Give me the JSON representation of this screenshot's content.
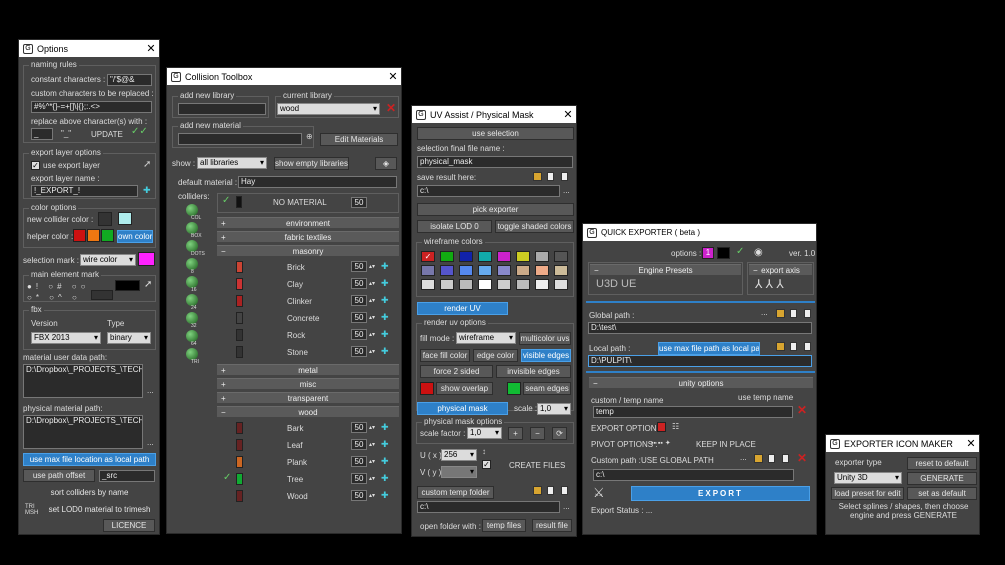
{
  "options": {
    "title": "Options",
    "naming_rules": "naming rules",
    "constant_label": "constant characters :",
    "constant_value": "\"/'$@&",
    "custom_label": "custom characters to be replaced :",
    "custom_value": "#%^*{}-=+[]\\|{};:.<>",
    "replace_label": "replace above character(s) with :",
    "replace_value": "_",
    "quote": "\"_\"",
    "update": "UPDATE",
    "export_layer_options": "export layer options",
    "use_export_layer": "use export layer",
    "export_layer_name_label": "export layer name :",
    "export_layer_name": "!_EXPORT_!",
    "color_options": "color options",
    "new_collider_color": "new collider color :",
    "helper_color": "helper color :",
    "own_color": "own color",
    "selection_mark": "selection mark :",
    "wire_color": "wire color",
    "main_element_mark": "main element mark",
    "fbx": "fbx",
    "version_label": "Version",
    "type_label": "Type",
    "version": "FBX 2013",
    "type": "binary",
    "mat_user_data_label": "material user data path:",
    "mat_user_data": "D:\\Dropbox\\_PROJECTS_\\TECH\\Scripts\\multi_exporter\\ini\\phx_user_data.ini",
    "phys_mat_label": "physical material path:",
    "phys_mat": "D:\\Dropbox\\_PROJECTS_\\TECH\\Scripts\\multi_exporter\\ini\\phx_mat.ini",
    "use_max_file": "use max file location as local path",
    "use_path_offset": "use path offset",
    "path_offset": "_src",
    "sort_colliders": "sort colliders by name",
    "set_lod0": "set LOD0 material to trimesh",
    "licence": "LICENCE",
    "ellipsis": "..."
  },
  "collision": {
    "title": "Collision Toolbox",
    "add_new_library": "add new library",
    "current_library": "current library",
    "current_value": "wood",
    "add_new_material": "add new material",
    "edit_materials": "Edit Materials",
    "show_label": "show :",
    "show_value": "all libraries",
    "show_empty": "show empty libraries",
    "default_material_label": "default material :",
    "default_material": "Hay",
    "colliders": "colliders:",
    "no_material": "NO MATERIAL",
    "num_default": "50",
    "groups": [
      {
        "name": "environment",
        "open": false
      },
      {
        "name": "fabric textiles",
        "open": false
      },
      {
        "name": "masonry",
        "open": true,
        "items": [
          "Brick",
          "Clay",
          "Clinker",
          "Concrete",
          "Rock",
          "Stone"
        ]
      },
      {
        "name": "metal",
        "open": false
      },
      {
        "name": "misc",
        "open": false
      },
      {
        "name": "transparent",
        "open": false
      },
      {
        "name": "wood",
        "open": true,
        "items": [
          "Bark",
          "Leaf",
          "Plank",
          "Tree",
          "Wood"
        ]
      }
    ],
    "collider_labels": [
      "COL",
      "BOX",
      "DOTS",
      "8",
      "16",
      "24",
      "32",
      "64",
      "TRI"
    ]
  },
  "uv": {
    "title": "UV Assist / Physical Mask",
    "use_selection": "use selection",
    "final_name_label": "selection final file name :",
    "final_name": "physical_mask",
    "save_result": "save result here:",
    "save_path": "c:\\",
    "pick_exporter": "pick exporter",
    "isolate_lod0": "isolate LOD 0",
    "toggle_shaded": "toggle shaded colors",
    "wireframe_colors": "wireframe colors",
    "render_uv": "render UV",
    "render_uv_options": "render uv options",
    "fill_mode": "fill mode :",
    "fill_value": "wireframe",
    "multicolor": "multicolor uvs",
    "face_fill": "face fill color",
    "edge_color": "edge color",
    "visible_edges": "visible edges",
    "force_2sided": "force 2 sided",
    "invisible_edges": "invisible edges",
    "show_overlap": "show overlap",
    "seam_edges": "seam edges",
    "physical_mask": "physical mask",
    "scale_label": "scale :",
    "scale_value": "1,0",
    "phys_mask_options": "physical mask options",
    "scale_factor": "scale factor :",
    "sf_value": "1,0",
    "u_label": "U ( x )",
    "v_label": "V ( y )",
    "u_value": "256",
    "create_files": "CREATE FILES",
    "custom_temp": "custom temp folder",
    "temp_path": "c:\\",
    "open_folder": "open folder with :",
    "temp_files": "temp files",
    "result_file": "result file"
  },
  "qe": {
    "title": "QUICK EXPORTER ( beta )",
    "options": "options :",
    "opt1": "1",
    "version": "ver. 1.0",
    "engine_presets": "Engine Presets",
    "export_axis": "export axis",
    "global_path_label": "Global path :",
    "global_path": "D:\\test\\",
    "local_path_label": "Local path :",
    "use_max_path": "use max file path as local path",
    "local_path": "D:\\PULPIT\\",
    "unity_options": "unity options",
    "custom_temp_name": "custom / temp name",
    "use_temp_name": "use temp name",
    "temp_name": "temp",
    "export_options": "EXPORT OPTIONS :",
    "pivot_options": "PIVOT OPTIONS :",
    "keep_in_place": "KEEP IN PLACE",
    "custom_path_label": "Custom path :",
    "use_global": "USE GLOBAL PATH",
    "custom_path": "c:\\",
    "export": "EXPORT",
    "export_status": "Export Status : ...",
    "ellipsis": "..."
  },
  "eim": {
    "title": "EXPORTER ICON MAKER",
    "exporter_type": "exporter type",
    "reset": "reset to default",
    "type_value": "Unity 3D",
    "generate": "GENERATE",
    "load_preset": "load preset for edit",
    "set_default": "set as default",
    "hint": "Select splines / shapes, then choose engine and press GENERATE"
  },
  "colors": {
    "pink": "#ff22ff",
    "red": "#cc1111",
    "orange": "#ee7711",
    "green": "#11aa22",
    "cyan": "#aaeeee",
    "blue": "#2e80c8"
  }
}
